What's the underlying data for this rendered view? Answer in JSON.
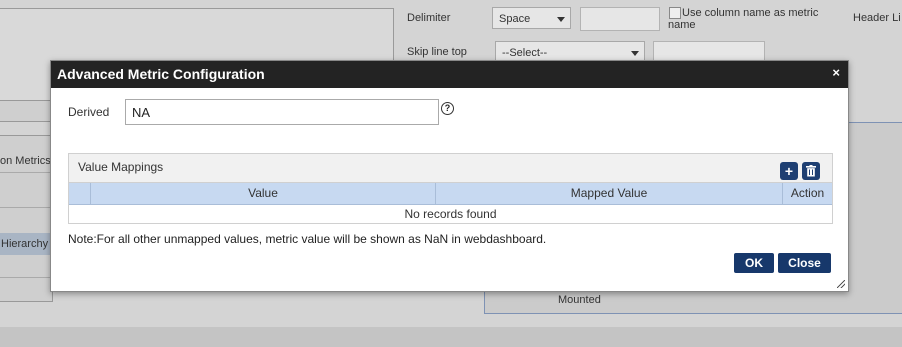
{
  "background": {
    "delimiter_label": "Delimiter",
    "delimiter_value": "Space",
    "use_column_name_label": "Use column name as metric name",
    "header_label": "Header Li",
    "skip_line_top_label": "Skip line top",
    "skip_line_top_value": "--Select--",
    "left_metrics_label": "on Metrics",
    "left_hierarchy_label": "Hierarchy",
    "mounted_label": "Mounted"
  },
  "modal": {
    "title": "Advanced Metric Configuration",
    "close_glyph": "×",
    "derived_label": "Derived",
    "derived_value": "NA",
    "help_glyph": "?",
    "value_mappings": {
      "title": "Value Mappings",
      "add_icon": "+",
      "delete_icon": "🗑",
      "columns": [
        "Value",
        "Mapped Value",
        "Action"
      ],
      "empty_text": "No records found"
    },
    "note": "Note:For all other unmapped values, metric value will be shown as NaN in webdashboard.",
    "ok_label": "OK",
    "close_label": "Close"
  },
  "colors": {
    "header_bg": "#232323",
    "button_bg": "#17386b",
    "table_header_bg": "#c7d9f1"
  }
}
